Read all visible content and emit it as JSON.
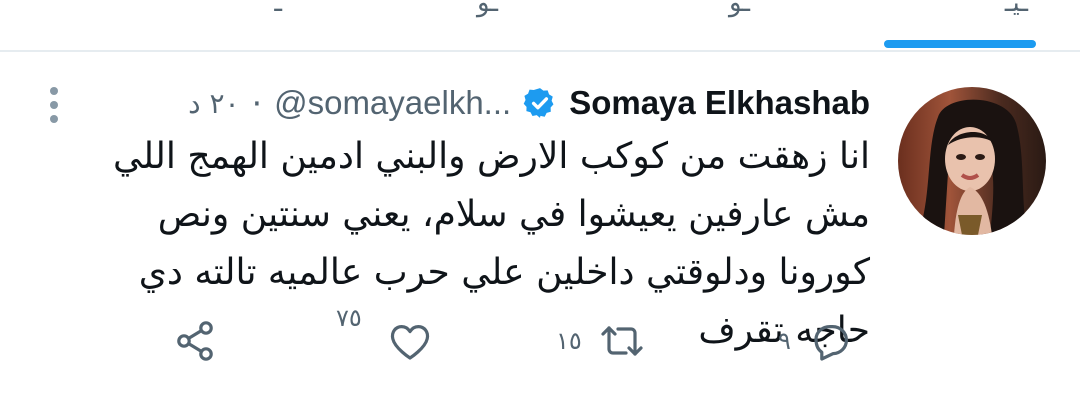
{
  "colors": {
    "accent": "#1d9bf0",
    "text": "#0f1419",
    "secondary": "#536471",
    "divider": "#e6ecf0"
  },
  "tabs": {
    "labels_cut": [
      "ـيـ",
      "ـو",
      "ـو",
      "ـ"
    ]
  },
  "tweet": {
    "author": {
      "display_name": "Somaya Elkhashab",
      "verified": true,
      "handle": "@somayaelkh...",
      "avatar_icon": "profile-photo"
    },
    "time": "٢٠ د",
    "dot": "·",
    "more_icon": "vertical-dots-icon",
    "text": "انا زهقت من كوكب الارض والبني ادمين الهمج اللي مش عارفين يعيشوا في سلام، يعني سنتين ونص كورونا ودلوقتي داخلين علي حرب عالميه تالته دي حاجه تقرف",
    "actions": {
      "reply": {
        "icon": "reply-icon",
        "count": "٩"
      },
      "retweet": {
        "icon": "retweet-icon",
        "count": "١٥"
      },
      "like": {
        "icon": "heart-icon",
        "count": "٧٥"
      },
      "share": {
        "icon": "share-icon"
      }
    }
  }
}
